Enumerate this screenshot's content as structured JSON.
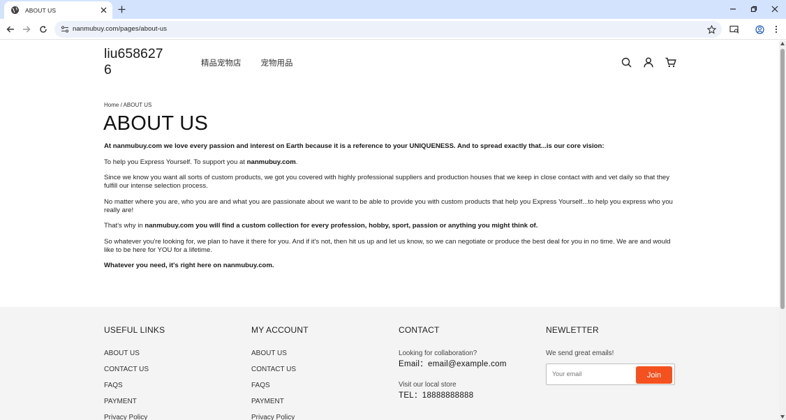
{
  "browser": {
    "tab_title": "ABOUT US",
    "url": "nanmubuy.com/pages/about-us"
  },
  "header": {
    "logo": "liu6586276",
    "nav": [
      {
        "label": "精品宠物店"
      },
      {
        "label": "宠物用品"
      }
    ]
  },
  "breadcrumb": "Home / ABOUT US",
  "page_title": "ABOUT US",
  "content": {
    "p1": "At nanmubuy.com we love every passion and interest on Earth because it is a reference to your UNIQUENESS. And to spread exactly that...is our core vision:",
    "p2_pre": "To help you Express Yourself. To support you at ",
    "p2_strong": "nanmubuy.com",
    "p2_post": ".",
    "p3": "Since we know you want all sorts of custom products, we got you covered with highly professional suppliers and production houses that we keep in close contact with and vet daily so that they fulfill our intense selection process.",
    "p4": "No matter where you are, who you are and what you are passionate about we want to be able to provide you with custom products that help you Express Yourself...to help you express who you really are!",
    "p5_pre": "That's why in ",
    "p5_strong": "nanmubuy.com you will find a custom collection for every profession, hobby, sport, passion or anything you might think of.",
    "p6": "So whatever you're looking for, we plan to have it there for you. And if it's not, then hit us up and let us know, so we can negotiate or produce the best deal for you in no time. We are and would like to be here for YOU for a lifetime.",
    "p7": "Whatever you need, it's right here on nanmubuy.com."
  },
  "footer": {
    "useful_links": {
      "heading": "USEFUL LINKS",
      "items": [
        "ABOUT US",
        "CONTACT US",
        "FAQS",
        "PAYMENT",
        "Privacy Policy"
      ]
    },
    "my_account": {
      "heading": "MY ACCOUNT",
      "items": [
        "ABOUT US",
        "CONTACT US",
        "FAQS",
        "PAYMENT",
        "Privacy Policy"
      ]
    },
    "contact": {
      "heading": "CONTACT",
      "collab_label": "Looking for collaboration?",
      "email": "Email：email@example.com",
      "store_label": "Visit our local store",
      "tel": "TEL：18888888888"
    },
    "newsletter": {
      "heading": "NEWLETTER",
      "text": "We send great emails!",
      "placeholder": "Your email",
      "button": "Join"
    }
  },
  "colors": {
    "tabstrip": "#d3e3fd",
    "join_button": "#f4511e",
    "footer_bg": "#f4f4f4"
  }
}
